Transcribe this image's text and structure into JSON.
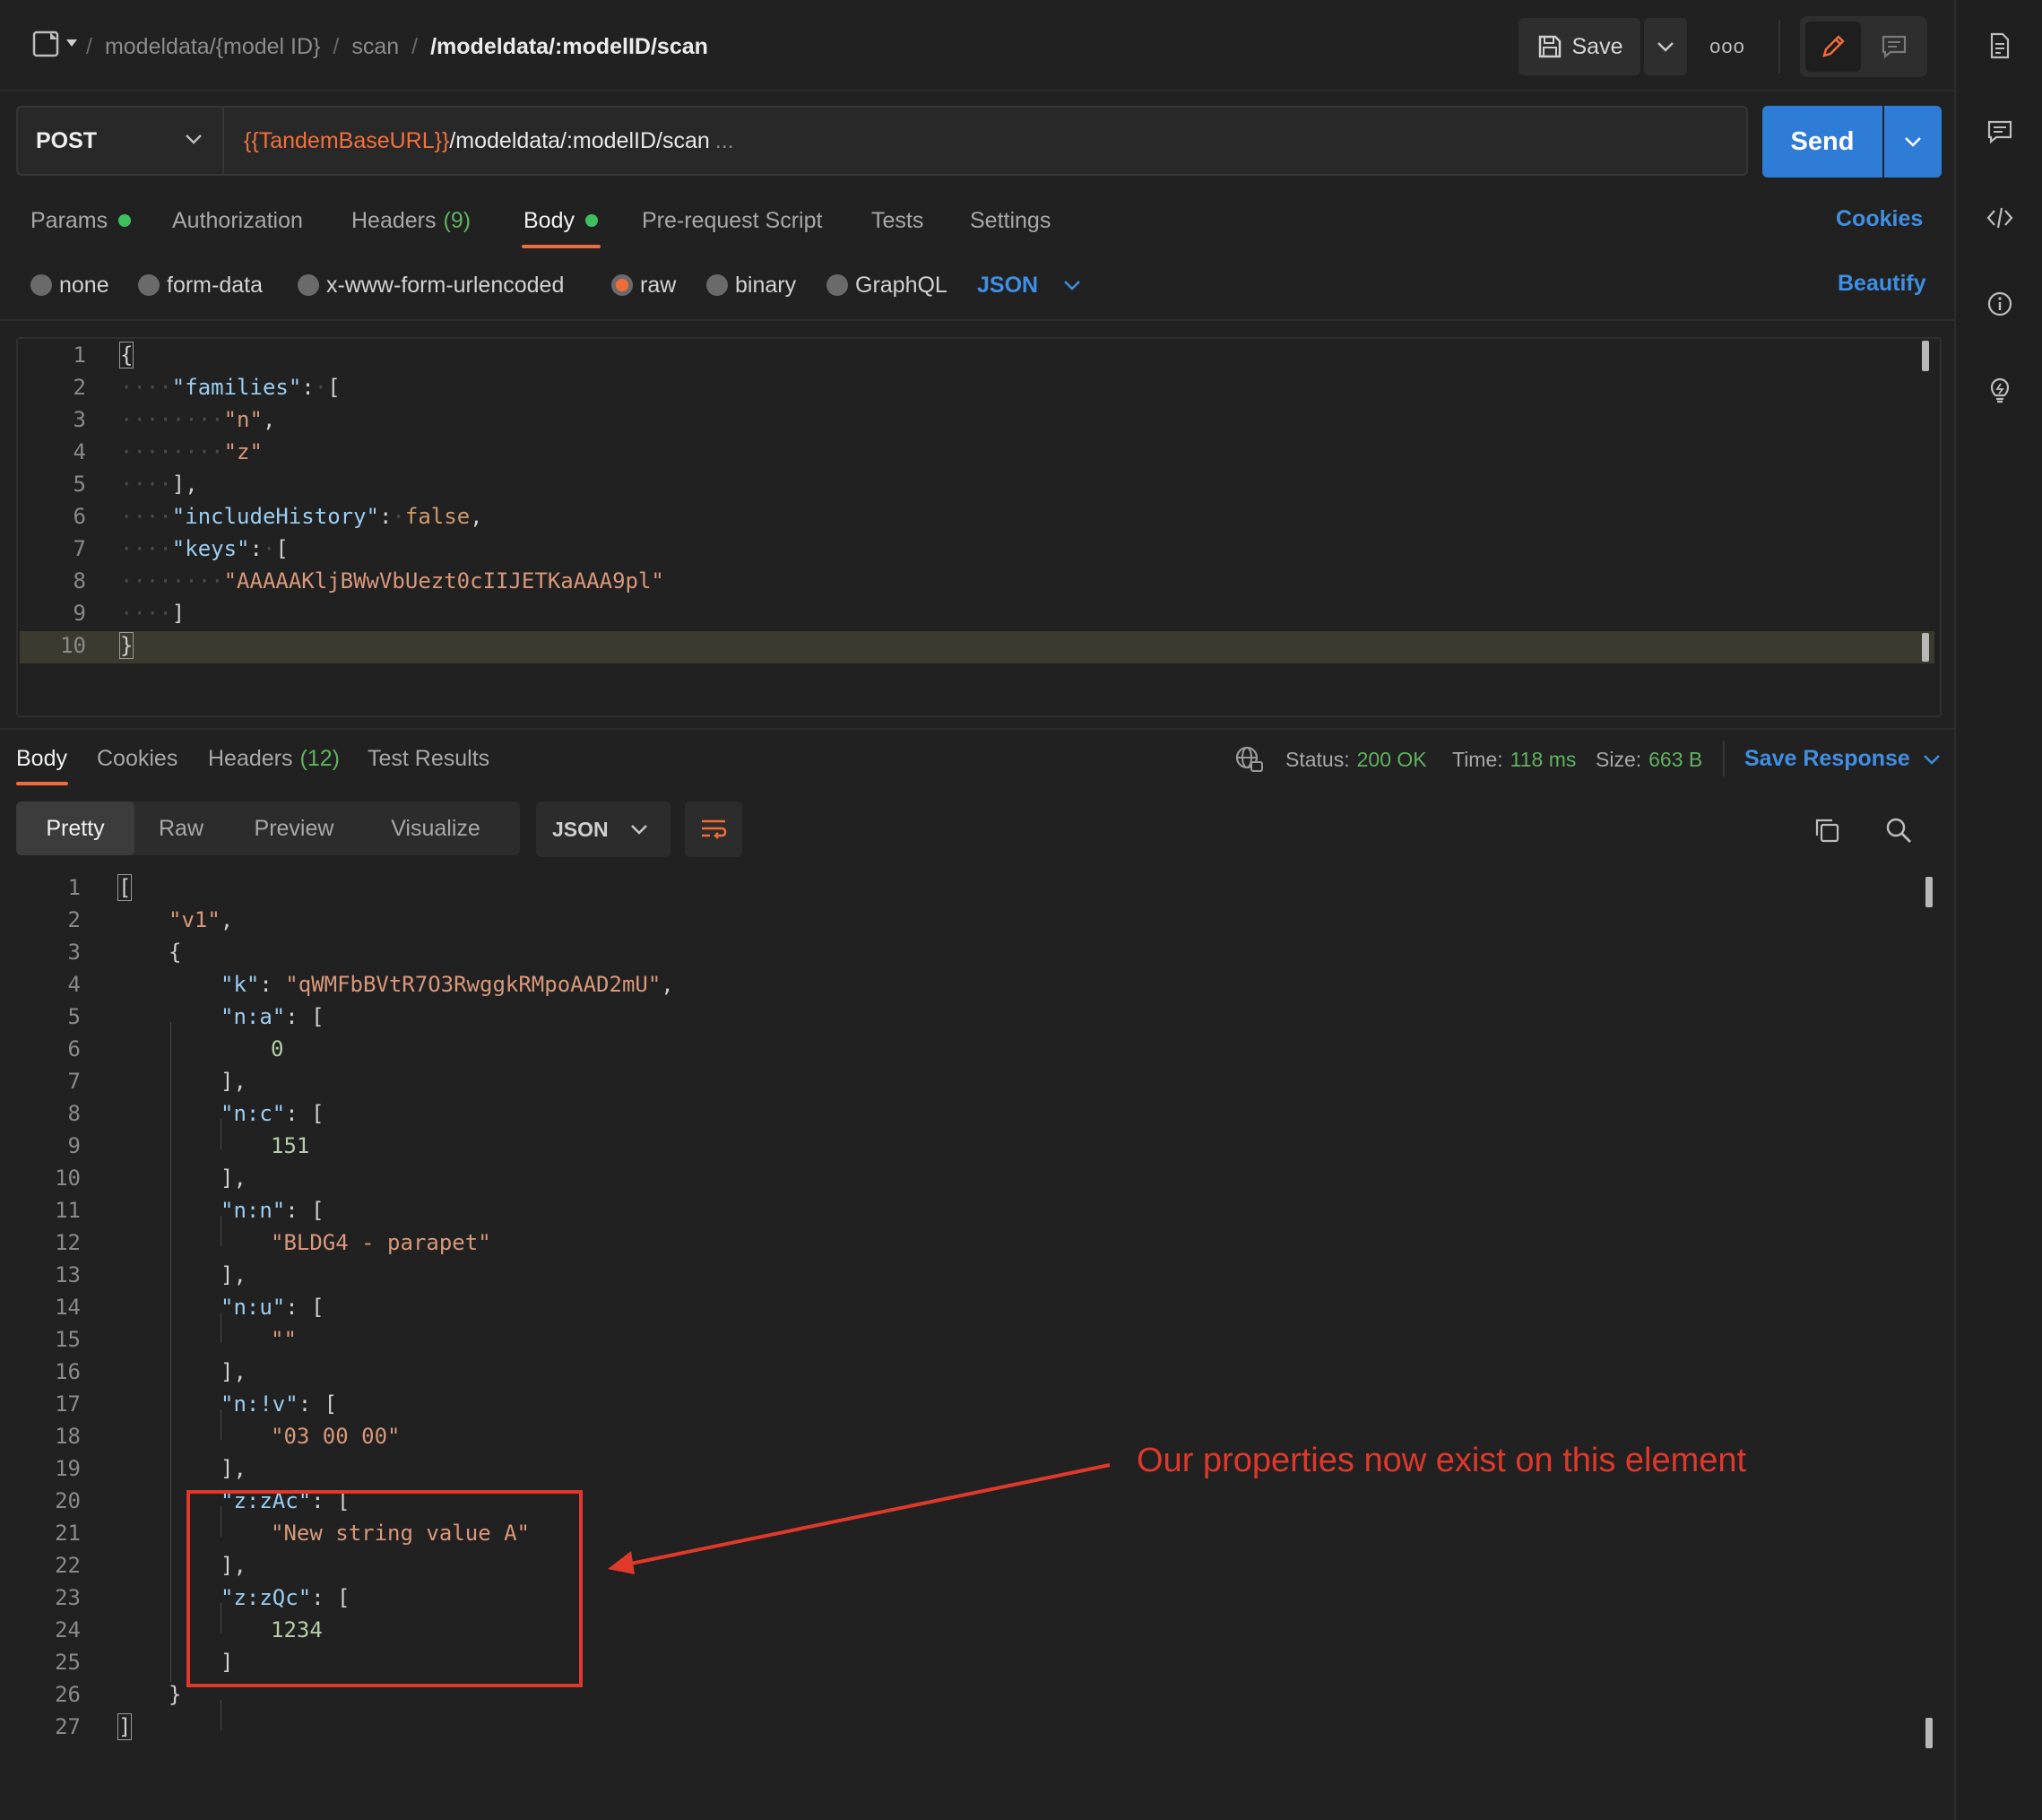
{
  "header": {
    "breadcrumb": [
      {
        "label": "modeldata/{model ID}"
      },
      {
        "label": "scan"
      }
    ],
    "separator": "/",
    "current": "/modeldata/:modelID/scan",
    "save_label": "Save",
    "more_label": "ooo"
  },
  "request": {
    "method": "POST",
    "url_var": "{{TandemBaseURL}}",
    "url_path": "/modeldata/:modelID/scan",
    "url_ellipsis": "...",
    "send_label": "Send"
  },
  "request_tabs": [
    {
      "label": "Params",
      "count": "",
      "dot": true
    },
    {
      "label": "Authorization",
      "count": "",
      "dot": false
    },
    {
      "label": "Headers",
      "count": "(9)",
      "dot": false
    },
    {
      "label": "Body",
      "count": "",
      "dot": true
    },
    {
      "label": "Pre-request Script",
      "count": "",
      "dot": false
    },
    {
      "label": "Tests",
      "count": "",
      "dot": false
    },
    {
      "label": "Settings",
      "count": "",
      "dot": false
    }
  ],
  "cookies_link": "Cookies",
  "beautify_link": "Beautify",
  "body_types": [
    {
      "label": "none",
      "selected": false
    },
    {
      "label": "form-data",
      "selected": false
    },
    {
      "label": "x-www-form-urlencoded",
      "selected": false
    },
    {
      "label": "raw",
      "selected": true
    },
    {
      "label": "binary",
      "selected": false
    },
    {
      "label": "GraphQL",
      "selected": false
    }
  ],
  "body_format": "JSON",
  "request_body_lines": [
    "1",
    "2",
    "3",
    "4",
    "5",
    "6",
    "7",
    "8",
    "9",
    "10"
  ],
  "request_body": {
    "families_key": "\"families\"",
    "fam1": "\"n\"",
    "fam2": "\"z\"",
    "history_key": "\"includeHistory\"",
    "history_val": "false",
    "keys_key": "\"keys\"",
    "key1": "\"AAAAAKljBWwVbUezt0cIIJETKaAAA9pl\""
  },
  "response": {
    "tabs": [
      {
        "label": "Body",
        "count": ""
      },
      {
        "label": "Cookies",
        "count": ""
      },
      {
        "label": "Headers",
        "count": "(12)"
      },
      {
        "label": "Test Results",
        "count": ""
      }
    ],
    "status_label": "Status:",
    "status_value": "200 OK",
    "time_label": "Time:",
    "time_value": "118 ms",
    "size_label": "Size:",
    "size_value": "663 B",
    "save_response": "Save Response",
    "view_tabs": [
      "Pretty",
      "Raw",
      "Preview",
      "Visualize"
    ],
    "format": "JSON",
    "body": {
      "v1": "\"v1\"",
      "k_key": "\"k\"",
      "k_val": "\"qWMFbBVtR7O3RwggkRMpoAAD2mU\"",
      "na_key": "\"n:a\"",
      "na_val": "0",
      "nc_key": "\"n:c\"",
      "nc_val": "151",
      "nn_key": "\"n:n\"",
      "nn_val": "\"BLDG4 - parapet\"",
      "nu_key": "\"n:u\"",
      "nu_val": "\"\"",
      "nv_key": "\"n:!v\"",
      "nv_val": "\"03 00 00\"",
      "zac_key": "\"z:zAc\"",
      "zac_val": "\"New string value A\"",
      "zqc_key": "\"z:zQc\"",
      "zqc_val": "1234"
    }
  },
  "annotation": {
    "text": "Our properties now exist on this element",
    "color": "#e0382a"
  },
  "colors": {
    "accent": "#f26b3a",
    "send_blue": "#2e7cd6",
    "link_blue": "#3f8fe4",
    "ok_green": "#5fb35f"
  }
}
